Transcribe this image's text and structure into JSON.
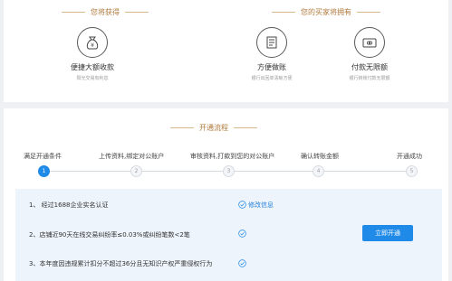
{
  "top": {
    "you_get_title": "您将获得",
    "buyer_title": "您的买家将拥有",
    "features": [
      {
        "name": "便捷大额收款",
        "sub": "阳光交易有利息",
        "icon": "money-bag-icon"
      },
      {
        "name": "方便做账",
        "sub": "银行出回单清晰方便",
        "icon": "receipt-icon"
      },
      {
        "name": "付款无限额",
        "sub": "银行转账付款无限额",
        "icon": "card-icon"
      }
    ]
  },
  "process": {
    "title": "开通流程",
    "steps": [
      {
        "label": "满足开通条件",
        "num": "1"
      },
      {
        "label": "上传资料,绑定对公账户",
        "num": "2"
      },
      {
        "label": "审核资料,打款到您的对公账户",
        "num": "3"
      },
      {
        "label": "确认转账金额",
        "num": "4"
      },
      {
        "label": "开通成功",
        "num": "5"
      }
    ],
    "requirements": [
      {
        "text": "1、 经过1688企业实名认证"
      },
      {
        "text": "2、店铺近90天在线交易纠纷率≤0.03%或纠纷笔数<2笔"
      },
      {
        "text": "3、本年度因违规累计扣分不超过36分且无知识产权严重侵权行为"
      }
    ],
    "edit_link": "修改信息",
    "open_button": "立即开通"
  }
}
